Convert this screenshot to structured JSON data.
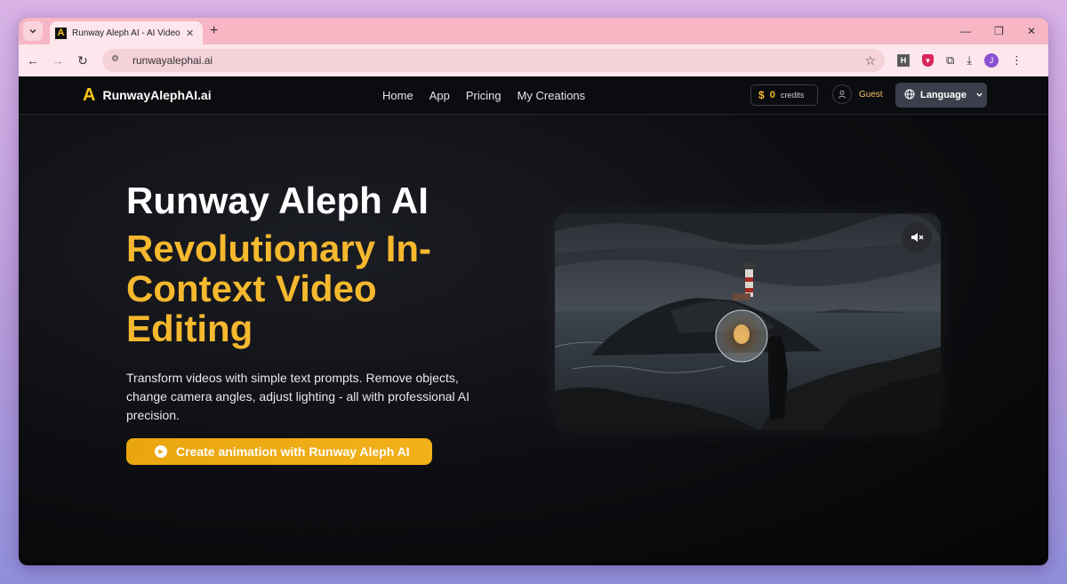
{
  "browser": {
    "tab_title": "Runway Aleph AI - AI Video Edi",
    "url": "runwayalephai.ai",
    "profile_initial": "J",
    "ext_h": "H"
  },
  "site": {
    "logo_mark": "A",
    "logo_text": "RunwayAlephAI.ai",
    "nav": [
      "Home",
      "App",
      "Pricing",
      "My Creations"
    ],
    "credits_symbol": "$",
    "credits_value": "0",
    "credits_label": "credits",
    "guest_label": "Guest",
    "language_label": "Language"
  },
  "hero": {
    "title": "Runway Aleph AI",
    "subtitle": "Revolutionary In-Context Video Editing",
    "description": "Transform videos with simple text prompts. Remove objects, change camera angles, adjust lighting - all with professional AI precision.",
    "cta_label": "Create animation with Runway Aleph AI"
  },
  "colors": {
    "accent": "#f5b82e",
    "tab_strip": "#f7b6c4",
    "page_bg": "#0c0d10"
  }
}
